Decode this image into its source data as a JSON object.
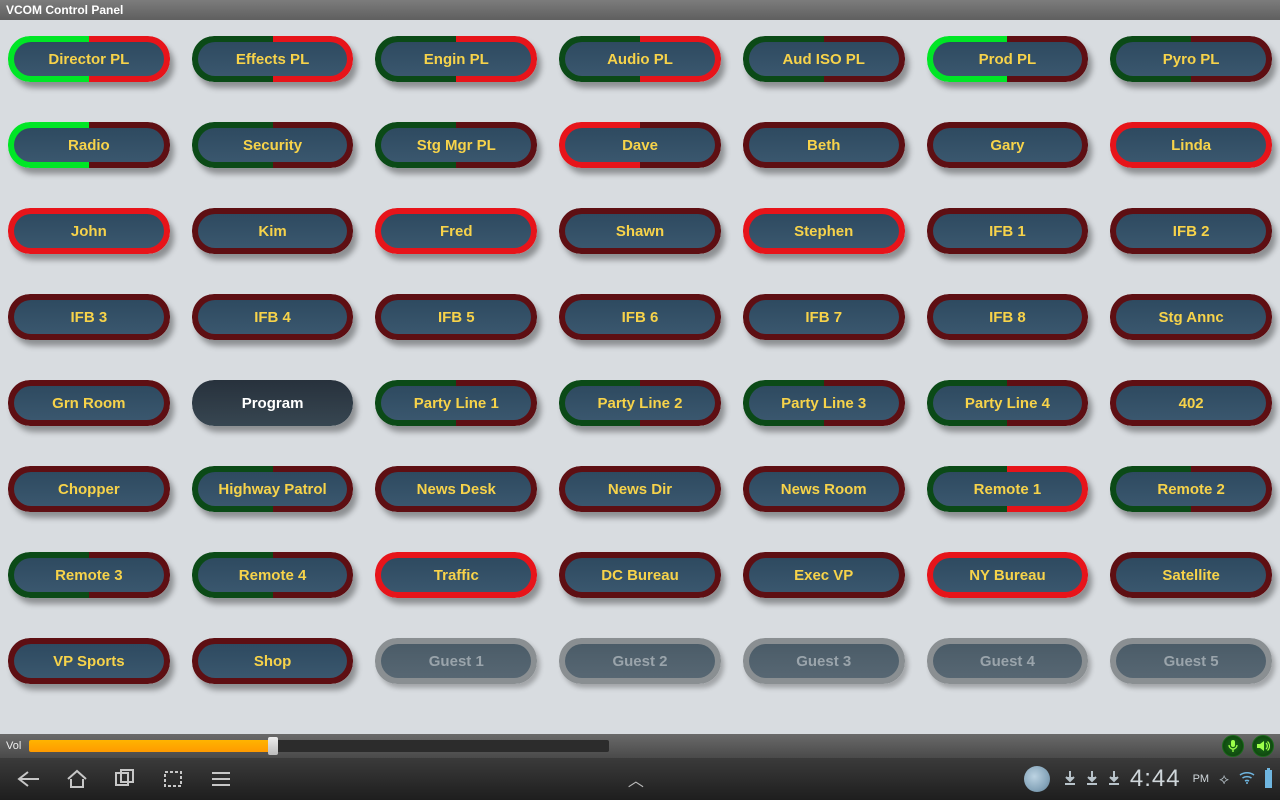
{
  "title": "VCOM Control Panel",
  "volume": {
    "label": "Vol",
    "percent": 42,
    "mic_icon": "mic-icon",
    "speaker_icon": "speaker-icon"
  },
  "nav": {
    "clock": "4:44",
    "ampm": "PM",
    "icons": [
      "back-icon",
      "home-icon",
      "recent-icon",
      "crop-icon",
      "menu-icon"
    ]
  },
  "buttons": [
    {
      "label": "Director PL",
      "left": "bgreen",
      "right": "bred"
    },
    {
      "label": "Effects PL",
      "left": "dgreen",
      "right": "bred"
    },
    {
      "label": "Engin PL",
      "left": "dgreen",
      "right": "bred"
    },
    {
      "label": "Audio PL",
      "left": "dgreen",
      "right": "bred"
    },
    {
      "label": "Aud ISO PL",
      "left": "dgreen",
      "right": "dred"
    },
    {
      "label": "Prod PL",
      "left": "bgreen",
      "right": "dred"
    },
    {
      "label": "Pyro PL",
      "left": "dgreen",
      "right": "dred"
    },
    {
      "label": "Radio",
      "left": "bgreen",
      "right": "dred"
    },
    {
      "label": "Security",
      "left": "dgreen",
      "right": "dred"
    },
    {
      "label": "Stg Mgr PL",
      "left": "dgreen",
      "right": "dred"
    },
    {
      "label": "Dave",
      "left": "bred",
      "right": "dred"
    },
    {
      "label": "Beth",
      "left": "dred",
      "right": "dred"
    },
    {
      "label": "Gary",
      "left": "dred",
      "right": "dred"
    },
    {
      "label": "Linda",
      "left": "bred",
      "right": "bred"
    },
    {
      "label": "John",
      "left": "bred",
      "right": "bred"
    },
    {
      "label": "Kim",
      "left": "dred",
      "right": "dred"
    },
    {
      "label": "Fred",
      "left": "bred",
      "right": "bred"
    },
    {
      "label": "Shawn",
      "left": "dred",
      "right": "dred"
    },
    {
      "label": "Stephen",
      "left": "bred",
      "right": "bred"
    },
    {
      "label": "IFB 1",
      "left": "dred",
      "right": "dred"
    },
    {
      "label": "IFB 2",
      "left": "dred",
      "right": "dred"
    },
    {
      "label": "IFB 3",
      "left": "dred",
      "right": "dred"
    },
    {
      "label": "IFB 4",
      "left": "dred",
      "right": "dred"
    },
    {
      "label": "IFB 5",
      "left": "dred",
      "right": "dred"
    },
    {
      "label": "IFB 6",
      "left": "dred",
      "right": "dred"
    },
    {
      "label": "IFB 7",
      "left": "dred",
      "right": "dred"
    },
    {
      "label": "IFB 8",
      "left": "dred",
      "right": "dred"
    },
    {
      "label": "Stg  Annc",
      "left": "dred",
      "right": "dred"
    },
    {
      "label": "Grn Room",
      "left": "dred",
      "right": "dred"
    },
    {
      "label": "Program",
      "variant": "program"
    },
    {
      "label": "Party Line 1",
      "left": "dgreen",
      "right": "dred"
    },
    {
      "label": "Party Line 2",
      "left": "dgreen",
      "right": "dred"
    },
    {
      "label": "Party Line 3",
      "left": "dgreen",
      "right": "dred"
    },
    {
      "label": "Party Line 4",
      "left": "dgreen",
      "right": "dred"
    },
    {
      "label": "402",
      "left": "dred",
      "right": "dred"
    },
    {
      "label": "Chopper",
      "left": "dred",
      "right": "dred"
    },
    {
      "label": "Highway Patrol",
      "left": "dgreen",
      "right": "dred"
    },
    {
      "label": "News Desk",
      "left": "dred",
      "right": "dred"
    },
    {
      "label": "News Dir",
      "left": "dred",
      "right": "dred"
    },
    {
      "label": "News Room",
      "left": "dred",
      "right": "dred"
    },
    {
      "label": "Remote 1",
      "left": "dgreen",
      "right": "bred"
    },
    {
      "label": "Remote 2",
      "left": "dgreen",
      "right": "dred"
    },
    {
      "label": "Remote 3",
      "left": "dgreen",
      "right": "dred"
    },
    {
      "label": "Remote 4",
      "left": "dgreen",
      "right": "dred"
    },
    {
      "label": "Traffic",
      "left": "bred",
      "right": "bred"
    },
    {
      "label": "DC Bureau",
      "left": "dred",
      "right": "dred"
    },
    {
      "label": "Exec VP",
      "left": "dred",
      "right": "dred"
    },
    {
      "label": "NY Bureau",
      "left": "bred",
      "right": "bred"
    },
    {
      "label": "Satellite",
      "left": "dred",
      "right": "dred"
    },
    {
      "label": "VP Sports",
      "left": "dred",
      "right": "dred"
    },
    {
      "label": "Shop",
      "left": "dred",
      "right": "dred"
    },
    {
      "label": "Guest 1",
      "variant": "disabled"
    },
    {
      "label": "Guest 2",
      "variant": "disabled"
    },
    {
      "label": "Guest 3",
      "variant": "disabled"
    },
    {
      "label": "Guest 4",
      "variant": "disabled"
    },
    {
      "label": "Guest 5",
      "variant": "disabled"
    }
  ]
}
